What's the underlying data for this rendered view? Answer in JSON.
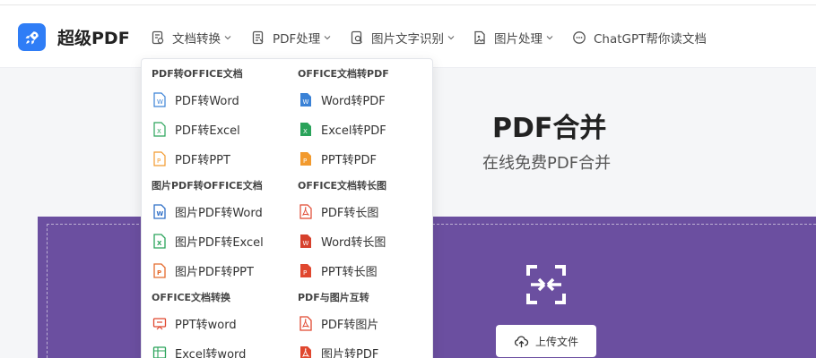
{
  "brand": {
    "name": "超级PDF",
    "logo_icon": "rocket-icon",
    "color": "#2f7df6"
  },
  "nav": [
    {
      "label": "文档转换",
      "icon": "doc-convert-icon",
      "has_dropdown": true
    },
    {
      "label": "PDF处理",
      "icon": "pdf-process-icon",
      "has_dropdown": true
    },
    {
      "label": "图片文字识别",
      "icon": "ocr-icon",
      "has_dropdown": true
    },
    {
      "label": "图片处理",
      "icon": "image-icon",
      "has_dropdown": true
    },
    {
      "label": "ChatGPT帮你读文档",
      "icon": "chat-icon",
      "has_dropdown": false
    }
  ],
  "hero": {
    "title": "PDF合并",
    "subtitle": "在线免费PDF合并"
  },
  "upload": {
    "button_label": "上传文件",
    "panel_color": "#6b4fa0"
  },
  "dropdown": {
    "sections": {
      "s1": "PDF转OFFICE文档",
      "s2": "OFFICE文档转PDF",
      "s3": "图片PDF转OFFICE文档",
      "s4": "OFFICE文档转长图",
      "s5": "OFFICE文档转换",
      "s6": "PDF与图片互转"
    },
    "items": {
      "pdf_word": "PDF转Word",
      "pdf_excel": "PDF转Excel",
      "pdf_ppt": "PDF转PPT",
      "word_pdf": "Word转PDF",
      "excel_pdf": "Excel转PDF",
      "ppt_pdf": "PPT转PDF",
      "img_pdf_word": "图片PDF转Word",
      "img_pdf_excel": "图片PDF转Excel",
      "img_pdf_ppt": "图片PDF转PPT",
      "pdf_long": "PDF转长图",
      "word_long": "Word转长图",
      "ppt_long": "PPT转长图",
      "ppt_word": "PPT转word",
      "excel_word": "Excel转word",
      "pdf_img": "PDF转图片",
      "img_pdf": "图片转PDF"
    },
    "colors": {
      "word": "#3b82d6",
      "excel": "#2aa35a",
      "ppt": "#f29a2e",
      "red": "#e0472f"
    }
  }
}
